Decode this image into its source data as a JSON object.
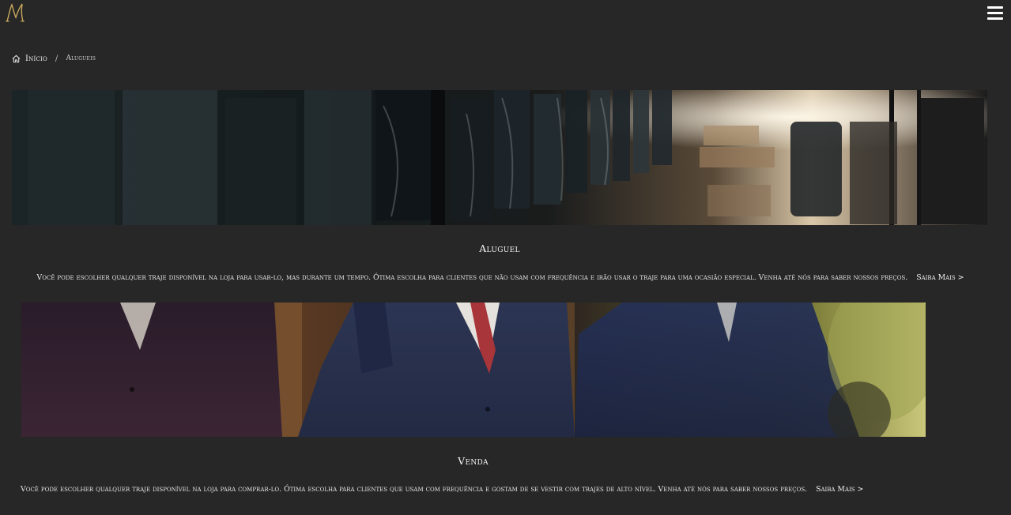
{
  "header": {
    "logo_letter": "M",
    "logo_color": "#c9a95c",
    "menu_icon": "hamburger-menu-icon"
  },
  "breadcrumb": {
    "home_icon": "home-icon",
    "home_label": "Início",
    "separator": "/",
    "current_label": "Alugueis"
  },
  "sections": [
    {
      "title": "Aluguel",
      "text": "Você pode escolher qualquer traje disponível na loja para usar-lo, mas durante um tempo. Ótima escolha para clientes que não usam com frequência e irão usar o traje para uma ocasião especial. Venha até nós para saber nossos preços.",
      "more_label": "Saiba Mais >"
    },
    {
      "title": "Venda",
      "text": "Você pode escolher qualquer traje disponível na loja para comprar-lo. Ótima escolha para clientes que usam com frequência e gostam de se vestir com trajes de alto nível. Venha até nós para saber nossos preços.",
      "more_label": "Saiba Mais >"
    }
  ]
}
